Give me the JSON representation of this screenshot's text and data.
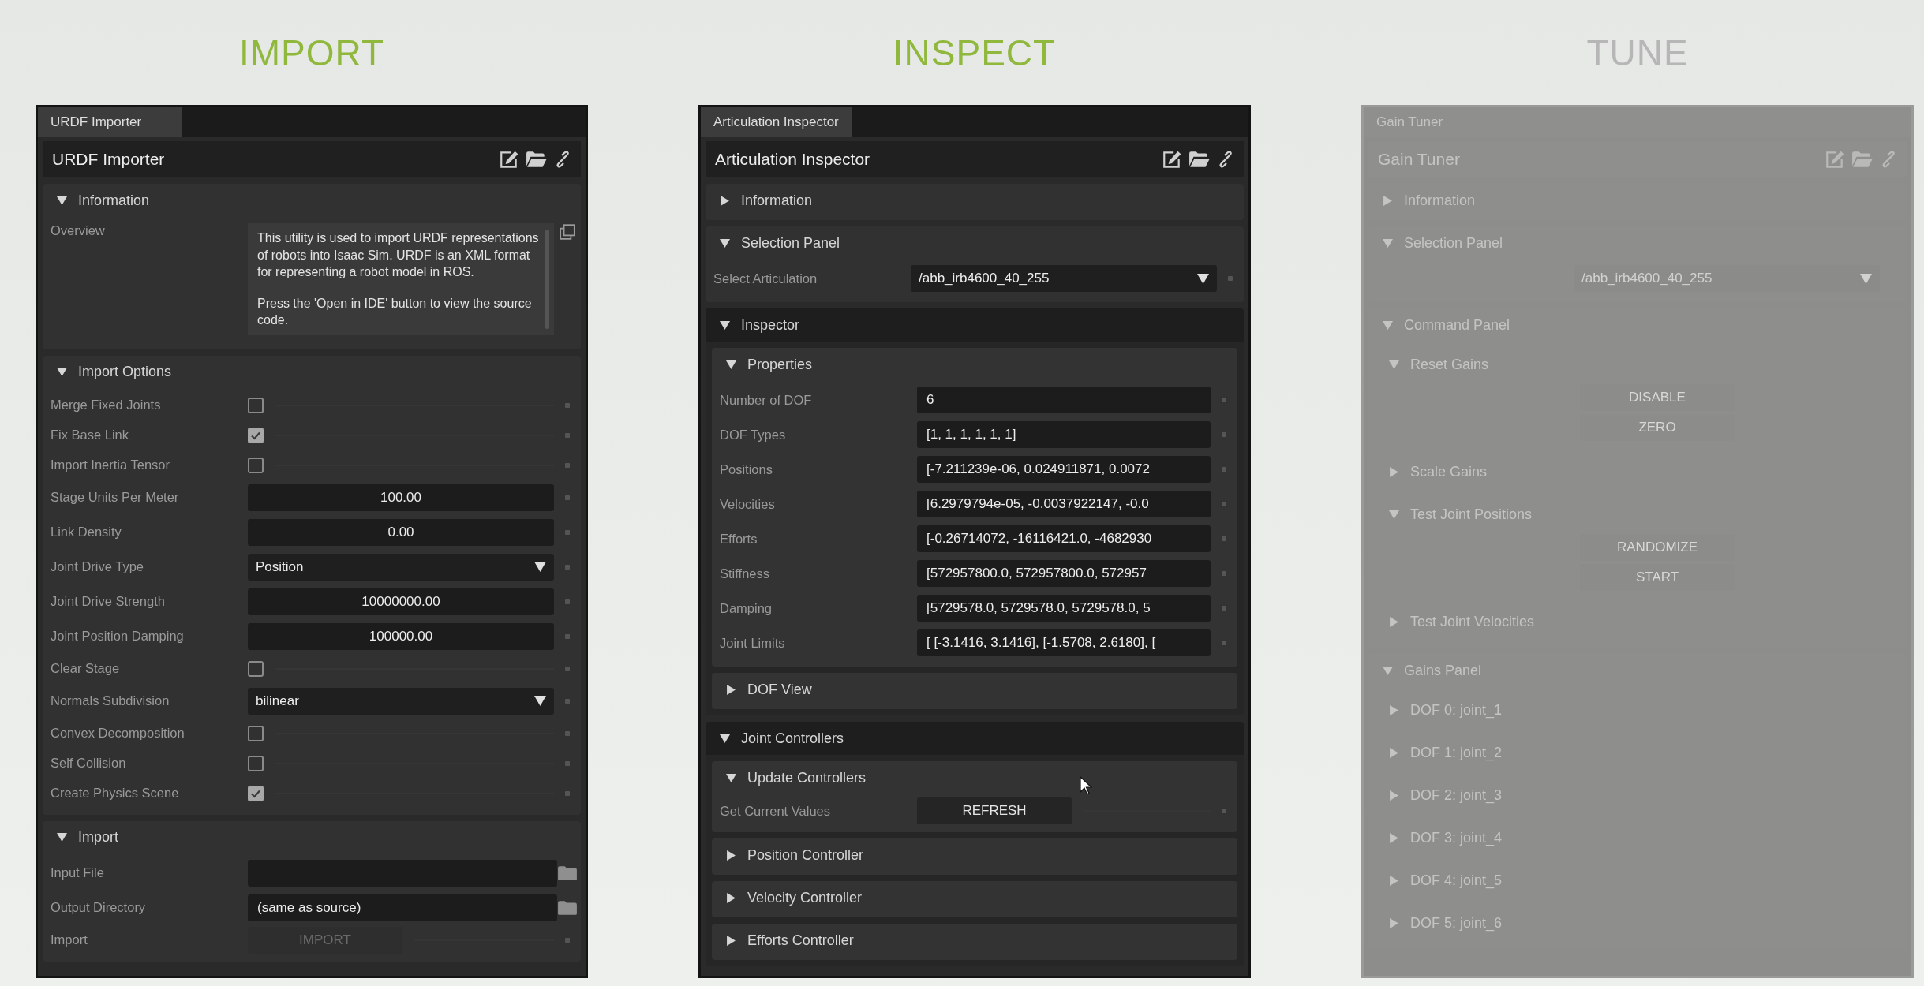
{
  "panels": [
    {
      "heading": "IMPORT",
      "faded": false,
      "tab": "URDF Importer",
      "title": "URDF Importer",
      "sections": [
        {
          "title": "Information",
          "expanded": true,
          "rows": [
            {
              "kind": "textarea",
              "label": "Overview",
              "paragraphs": [
                "This utility is used to import URDF representations of robots into Isaac Sim. URDF is an XML format for representing a robot model in ROS.",
                "Press the 'Open in IDE' button to view the source code."
              ]
            }
          ]
        },
        {
          "title": "Import Options",
          "expanded": true,
          "rows": [
            {
              "kind": "checkbox",
              "label": "Merge Fixed Joints",
              "checked": false
            },
            {
              "kind": "checkbox",
              "label": "Fix Base Link",
              "checked": true
            },
            {
              "kind": "checkbox",
              "label": "Import Inertia Tensor",
              "checked": false
            },
            {
              "kind": "number",
              "label": "Stage Units Per Meter",
              "value": "100.00"
            },
            {
              "kind": "number",
              "label": "Link Density",
              "value": "0.00"
            },
            {
              "kind": "dropdown",
              "label": "Joint Drive Type",
              "value": "Position"
            },
            {
              "kind": "number",
              "label": "Joint Drive Strength",
              "value": "10000000.00"
            },
            {
              "kind": "number",
              "label": "Joint Position Damping",
              "value": "100000.00"
            },
            {
              "kind": "checkbox",
              "label": "Clear Stage",
              "checked": false
            },
            {
              "kind": "dropdown",
              "label": "Normals Subdivision",
              "value": "bilinear"
            },
            {
              "kind": "checkbox",
              "label": "Convex Decomposition",
              "checked": false
            },
            {
              "kind": "checkbox",
              "label": "Self Collision",
              "checked": false
            },
            {
              "kind": "checkbox",
              "label": "Create Physics Scene",
              "checked": true
            }
          ]
        },
        {
          "title": "Import",
          "expanded": true,
          "rows": [
            {
              "kind": "file",
              "label": "Input File"
            },
            {
              "kind": "file",
              "label": "Output Directory",
              "value": "(same as source)"
            },
            {
              "kind": "button",
              "label": "Import",
              "button": "IMPORT",
              "disabled": true
            }
          ]
        }
      ]
    },
    {
      "heading": "INSPECT",
      "faded": false,
      "tab": "Articulation Inspector",
      "title": "Articulation Inspector",
      "sections": [
        {
          "title": "Information",
          "expanded": false
        },
        {
          "title": "Selection Panel",
          "expanded": true,
          "rows": [
            {
              "kind": "dropdown",
              "label": "Select Articulation",
              "value": "/abb_irb4600_40_255"
            }
          ]
        },
        {
          "title": "Inspector",
          "expanded": true,
          "children": [
            {
              "title": "Properties",
              "expanded": true,
              "rows": [
                {
                  "kind": "text",
                  "label": "Number of DOF",
                  "value": "6"
                },
                {
                  "kind": "text",
                  "label": "DOF Types",
                  "value": "[1, 1, 1, 1, 1, 1]"
                },
                {
                  "kind": "text",
                  "label": "Positions",
                  "value": "[-7.211239e-06, 0.024911871, 0.0072"
                },
                {
                  "kind": "text",
                  "label": "Velocities",
                  "value": "[6.2979794e-05, -0.0037922147, -0.0"
                },
                {
                  "kind": "text",
                  "label": "Efforts",
                  "value": "[-0.26714072, -16116421.0, -4682930"
                },
                {
                  "kind": "text",
                  "label": "Stiffness",
                  "value": "[572957800.0, 572957800.0, 572957"
                },
                {
                  "kind": "text",
                  "label": "Damping",
                  "value": "[5729578.0, 5729578.0, 5729578.0, 5"
                },
                {
                  "kind": "text",
                  "label": "Joint Limits",
                  "value": "[ [-3.1416, 3.1416], [-1.5708, 2.6180], ["
                }
              ]
            },
            {
              "title": "DOF View",
              "expanded": false
            }
          ]
        },
        {
          "title": "Joint Controllers",
          "expanded": true,
          "children": [
            {
              "title": "Update Controllers",
              "expanded": true,
              "rows": [
                {
                  "kind": "button",
                  "label": "Get Current Values",
                  "button": "REFRESH",
                  "disabled": false
                }
              ]
            },
            {
              "title": "Position Controller",
              "expanded": false
            },
            {
              "title": "Velocity Controller",
              "expanded": false
            },
            {
              "title": "Efforts Controller",
              "expanded": false
            }
          ]
        }
      ]
    },
    {
      "heading": "TUNE",
      "faded": true,
      "tab": "Gain Tuner",
      "title": "Gain Tuner",
      "sections": [
        {
          "title": "Information",
          "expanded": false
        },
        {
          "title": "Selection Panel",
          "expanded": true,
          "rows": [
            {
              "kind": "dropdown",
              "value": "/abb_irb4600_40_255"
            }
          ]
        },
        {
          "title": "Command Panel",
          "expanded": true,
          "children": [
            {
              "title": "Reset Gains",
              "expanded": true,
              "rows": [
                {
                  "kind": "button",
                  "button": "DISABLE",
                  "disabled": false
                },
                {
                  "kind": "button",
                  "button": "ZERO",
                  "disabled": false
                }
              ]
            },
            {
              "title": "Scale Gains",
              "expanded": false
            },
            {
              "title": "Test Joint Positions",
              "expanded": true,
              "rows": [
                {
                  "kind": "button",
                  "button": "RANDOMIZE",
                  "disabled": false
                },
                {
                  "kind": "button",
                  "button": "START",
                  "disabled": false
                }
              ]
            },
            {
              "title": "Test Joint Velocities",
              "expanded": false
            }
          ]
        },
        {
          "title": "Gains Panel",
          "expanded": true,
          "children": [
            {
              "title": "DOF 0: joint_1",
              "expanded": false
            },
            {
              "title": "DOF 1: joint_2",
              "expanded": false
            },
            {
              "title": "DOF 2: joint_3",
              "expanded": false
            },
            {
              "title": "DOF 3: joint_4",
              "expanded": false
            },
            {
              "title": "DOF 4: joint_5",
              "expanded": false
            },
            {
              "title": "DOF 5: joint_6",
              "expanded": false
            }
          ]
        }
      ]
    }
  ]
}
